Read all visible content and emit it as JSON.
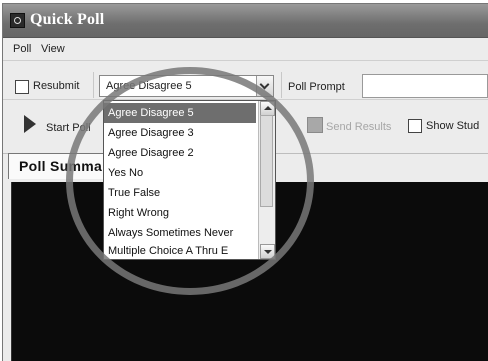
{
  "window": {
    "title": "Quick Poll"
  },
  "menu": [
    "Poll",
    "View"
  ],
  "toolbar": {
    "resubmit_label": "Resubmit",
    "resubmit_checked": false,
    "poll_type_value": "Agree Disagree 5",
    "poll_prompt_label": "Poll Prompt",
    "poll_prompt_value": "",
    "start_poll_label": "Start Poll",
    "send_results_label": "Send Results",
    "show_students_label": "Show Stud"
  },
  "tab": {
    "label": "Poll Summa"
  },
  "dropdown": {
    "items": [
      "Agree Disagree 5",
      "Agree Disagree 3",
      "Agree Disagree 2",
      "Yes No",
      "True False",
      "Right Wrong",
      "Always Sometimes Never",
      "Multiple Choice A Thru E"
    ],
    "selected_index": 0
  },
  "colors": {
    "titlebar": "#6e6e6e",
    "selection": "#6e6e6e",
    "content_bg": "#0b0b0b",
    "highlight_circle": "#787878"
  }
}
